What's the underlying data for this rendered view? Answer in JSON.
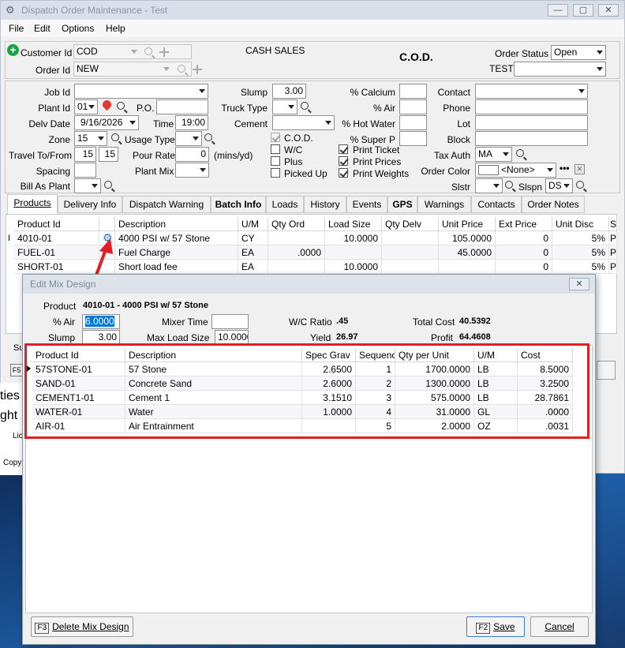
{
  "window": {
    "title": "Dispatch Order Maintenance - Test",
    "min": "—",
    "max": "▢",
    "close": "✕"
  },
  "menu": [
    "File",
    "Edit",
    "Options",
    "Help"
  ],
  "header": {
    "customer_label": "Customer Id",
    "customer_value": "COD",
    "customer_name": "CASH SALES",
    "cod_text": "C.O.D.",
    "order_label": "Order Id",
    "order_value": "NEW",
    "order_status_label": "Order Status",
    "order_status_value": "Open",
    "test_label": "TEST",
    "test_value": ""
  },
  "form": {
    "job_id": {
      "label": "Job Id",
      "value": ""
    },
    "plant_id": {
      "label": "Plant Id",
      "value": "01"
    },
    "po": {
      "label": "P.O.",
      "value": ""
    },
    "delv_date": {
      "label": "Delv Date",
      "value": "9/16/2026"
    },
    "time": {
      "label": "Time",
      "value": "19:00"
    },
    "zone": {
      "label": "Zone",
      "value": "15"
    },
    "usage_type": {
      "label": "Usage Type",
      "value": ""
    },
    "travel": {
      "label": "Travel To/From",
      "to": "15",
      "from": "15"
    },
    "pour_rate": {
      "label": "Pour Rate",
      "value": "0",
      "unit": "(mins/yd)"
    },
    "spacing": {
      "label": "Spacing",
      "value": ""
    },
    "plant_mix": {
      "label": "Plant Mix",
      "value": ""
    },
    "bill_as_plant": {
      "label": "Bill As Plant",
      "value": ""
    },
    "slump": {
      "label": "Slump",
      "value": "3.00"
    },
    "truck_type": {
      "label": "Truck Type",
      "value": ""
    },
    "cement": {
      "label": "Cement",
      "value": ""
    },
    "checks": {
      "cod": "C.O.D.",
      "wc": "W/C",
      "plus": "Plus",
      "picked_up": "Picked Up",
      "print_ticket": "Print Ticket",
      "print_prices": "Print Prices",
      "print_weights": "Print Weights"
    },
    "calcium": {
      "label": "% Calcium",
      "value": ""
    },
    "air": {
      "label": "% Air",
      "value": ""
    },
    "hot_water": {
      "label": "% Hot Water",
      "value": ""
    },
    "super_p": {
      "label": "% Super P",
      "value": ""
    },
    "contact": {
      "label": "Contact",
      "value": ""
    },
    "phone": {
      "label": "Phone",
      "value": ""
    },
    "lot": {
      "label": "Lot",
      "value": ""
    },
    "block": {
      "label": "Block",
      "value": ""
    },
    "tax_auth": {
      "label": "Tax Auth",
      "value": "MA"
    },
    "order_color": {
      "label": "Order Color",
      "value": "<None>"
    },
    "slstr": {
      "label": "Slstr",
      "value": ""
    },
    "slspn": {
      "label": "Slspn",
      "value": "DS"
    }
  },
  "tabs": [
    "Products",
    "Delivery Info",
    "Dispatch Warning",
    "Batch Info",
    "Loads",
    "History",
    "Events",
    "GPS",
    "Warnings",
    "Contacts",
    "Order Notes"
  ],
  "products": {
    "columns": [
      "Product Id",
      "",
      "Description",
      "U/M",
      "Qty Ord",
      "Load Size",
      "Qty Delv",
      "Unit Price",
      "Ext Price",
      "Unit Disc",
      "Sı"
    ],
    "rows": [
      [
        "4010-01",
        "",
        "4000 PSI w/ 57 Stone",
        "CY",
        "",
        "10.0000",
        "",
        "105.0000",
        "0",
        "5%",
        "P"
      ],
      [
        "FUEL-01",
        "",
        "Fuel Charge",
        "EA",
        ".0000",
        "",
        "",
        "45.0000",
        "0",
        "5%",
        "P"
      ],
      [
        "SHORT-01",
        "",
        "Short load fee",
        "EA",
        "",
        "10.0000",
        "",
        "",
        "0",
        "5%",
        "P"
      ]
    ]
  },
  "behind": {
    "su": "Su",
    "f5": "F5",
    "ties": "ties",
    "ght": "ght",
    "lic": "Lic",
    "copy": "Copy"
  },
  "dialog": {
    "title": "Edit Mix Design",
    "product_label": "Product",
    "product_value": "4010-01 - 4000 PSI w/ 57 Stone",
    "air_label": "% Air",
    "air_value": "6.0000",
    "mixer_time_label": "Mixer Time",
    "mixer_time_value": "",
    "wc_label": "W/C Ratio",
    "wc_value": ".45",
    "total_cost_label": "Total Cost",
    "total_cost_value": "40.5392",
    "slump_label": "Slump",
    "slump_value": "3.00",
    "max_load_label": "Max Load Size",
    "max_load_value": "10.0000",
    "yield_label": "Yield",
    "yield_value": "26.97",
    "profit_label": "Profit",
    "profit_value": "64.4608",
    "columns": [
      "Product Id",
      "Description",
      "Spec Grav",
      "Sequenc",
      "Qty per Unit",
      "U/M",
      "Cost"
    ],
    "rows": [
      [
        "57STONE-01",
        "57 Stone",
        "2.6500",
        "1",
        "1700.0000",
        "LB",
        "8.5000"
      ],
      [
        "SAND-01",
        "Concrete Sand",
        "2.6000",
        "2",
        "1300.0000",
        "LB",
        "3.2500"
      ],
      [
        "CEMENT1-01",
        "Cement 1",
        "3.1510",
        "3",
        "575.0000",
        "LB",
        "28.7861"
      ],
      [
        "WATER-01",
        "Water",
        "1.0000",
        "4",
        "31.0000",
        "GL",
        ".0000"
      ],
      [
        "AIR-01",
        "Air Entrainment",
        "",
        "5",
        "2.0000",
        "OZ",
        ".0031"
      ]
    ],
    "delete_key": "F3",
    "delete_label": "Delete Mix Design",
    "save_key": "F2",
    "save_label": "Save",
    "cancel_label": "Cancel",
    "close": "✕"
  },
  "colors": {
    "accent_red": "#e02020",
    "gear_blue": "#1f77d0",
    "pin_red": "#e53935",
    "add_green": "#17a340"
  }
}
